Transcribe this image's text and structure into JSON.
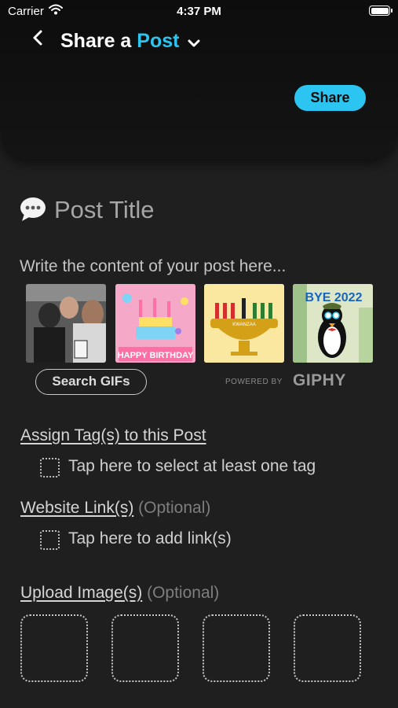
{
  "status_bar": {
    "carrier": "Carrier",
    "time": "4:37 PM"
  },
  "header": {
    "title_prefix": "Share a ",
    "title_accent": "Post",
    "accent_color": "#2cc4f0",
    "share_label": "Share"
  },
  "post": {
    "title_placeholder": "Post Title",
    "content_placeholder": "Write the content of your post here..."
  },
  "gifs": {
    "items": [
      {
        "name": "people-gif"
      },
      {
        "name": "happy-birthday-gif",
        "caption": "HAPPY BIRTHDAY"
      },
      {
        "name": "kwanzaa-gif",
        "caption": "KWANZAA"
      },
      {
        "name": "bye-2022-penguin-gif",
        "caption": "BYE 2022"
      }
    ],
    "search_label": "Search GIFs",
    "powered_by": "POWERED BY",
    "brand": "GIPHY"
  },
  "tags": {
    "label": "Assign Tag(s) to this Post",
    "picker_text": "Tap here to select at least one tag"
  },
  "links": {
    "label": "Website Link(s)",
    "optional": "(Optional)",
    "picker_text": "Tap here to add link(s)"
  },
  "images": {
    "label": "Upload Image(s)",
    "optional": "(Optional)",
    "slots": 4
  }
}
